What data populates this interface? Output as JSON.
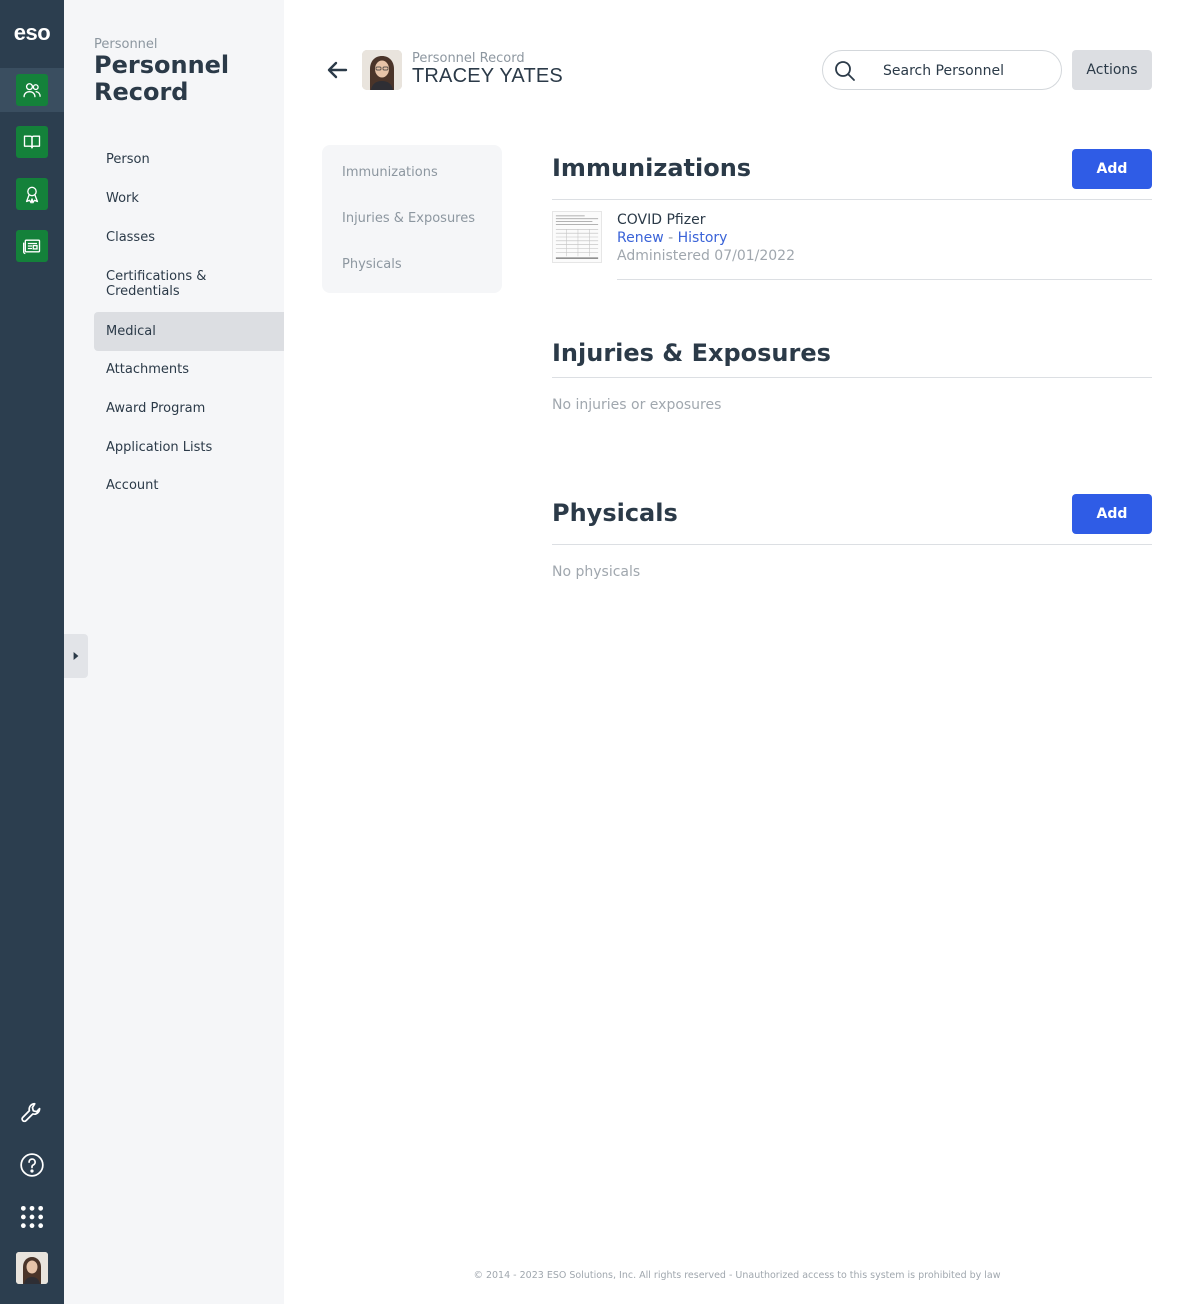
{
  "rail": {
    "logo": "eso"
  },
  "sidebar": {
    "breadcrumb": "Personnel",
    "title": "Personnel Record",
    "items": [
      {
        "label": "Person"
      },
      {
        "label": "Work"
      },
      {
        "label": "Classes"
      },
      {
        "label": "Certifications & Credentials"
      },
      {
        "label": "Medical",
        "active": true
      },
      {
        "label": "Attachments"
      },
      {
        "label": "Award Program"
      },
      {
        "label": "Application Lists"
      },
      {
        "label": "Account"
      }
    ]
  },
  "header": {
    "subtitle": "Personnel Record",
    "name": "TRACEY YATES",
    "search_placeholder": "Search Personnel",
    "actions_label": "Actions"
  },
  "section_nav": [
    "Immunizations",
    "Injuries & Exposures",
    "Physicals"
  ],
  "immunizations": {
    "title": "Immunizations",
    "add_label": "Add",
    "items": [
      {
        "name": "COVID Pfizer",
        "renew_label": "Renew",
        "separator": "-",
        "history_label": "History",
        "administered": "Administered 07/01/2022"
      }
    ]
  },
  "injuries": {
    "title": "Injuries & Exposures",
    "empty": "No injuries or exposures"
  },
  "physicals": {
    "title": "Physicals",
    "add_label": "Add",
    "empty": "No physicals"
  },
  "footer": "© 2014 - 2023 ESO Solutions, Inc. All rights reserved - Unauthorized access to this system is prohibited by law",
  "colors": {
    "rail": "#2c3e4f",
    "app_tile": "#14813a",
    "primary": "#2f5ce6",
    "link": "#3a63d8"
  }
}
